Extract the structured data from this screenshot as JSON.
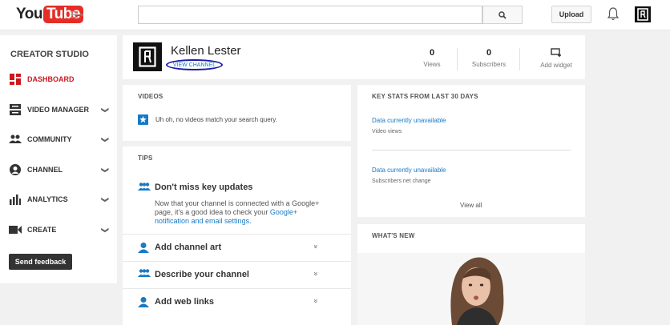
{
  "topbar": {
    "logo_you": "You",
    "logo_tube": "Tube",
    "search_placeholder": "",
    "upload_label": "Upload"
  },
  "sidebar": {
    "title": "CREATOR STUDIO",
    "items": [
      {
        "label": "DASHBOARD",
        "icon": "dashboard-icon"
      },
      {
        "label": "VIDEO MANAGER",
        "icon": "video-manager-icon"
      },
      {
        "label": "COMMUNITY",
        "icon": "community-icon"
      },
      {
        "label": "CHANNEL",
        "icon": "channel-icon"
      },
      {
        "label": "ANALYTICS",
        "icon": "analytics-icon"
      },
      {
        "label": "CREATE",
        "icon": "create-icon"
      }
    ],
    "feedback_label": "Send feedback"
  },
  "channel": {
    "name": "Kellen Lester",
    "view_channel": "VIEW CHANNEL",
    "views_value": "0",
    "views_label": "Views",
    "subscribers_value": "0",
    "subscribers_label": "Subscribers",
    "add_widget_label": "Add widget"
  },
  "videos": {
    "title": "VIDEOS",
    "empty_message": "Uh oh, no videos match your search query."
  },
  "tips": {
    "title": "TIPS",
    "headline": "Don't miss key updates",
    "body": "Now that your channel is connected with a Google+ page, it's a good idea to check your ",
    "body_link": "Google+ notification and email settings.",
    "rows": [
      {
        "label": "Add channel art"
      },
      {
        "label": "Describe your channel"
      },
      {
        "label": "Add web links"
      }
    ]
  },
  "keystats": {
    "title": "KEY STATS FROM LAST 30 DAYS",
    "stat1_status": "Data currently unavailable",
    "stat1_label": "Video views",
    "stat2_status": "Data currently unavailable",
    "stat2_label": "Subscribers net change",
    "view_all": "View all"
  },
  "whatsnew": {
    "title": "WHAT'S NEW"
  },
  "colors": {
    "accent_red": "#cc181e",
    "link_blue": "#167ac6",
    "annotation_ellipse": "#1a1aa8"
  }
}
